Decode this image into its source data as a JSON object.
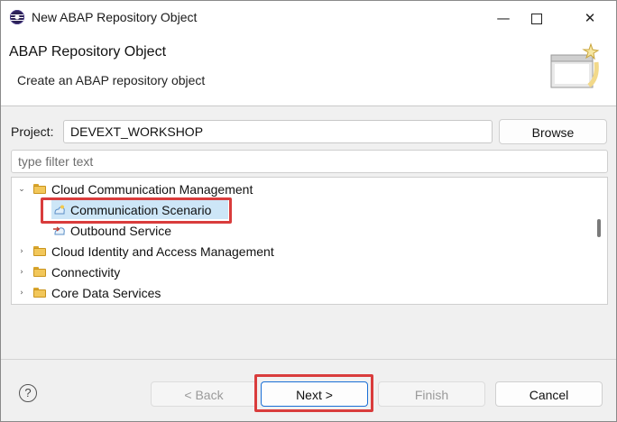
{
  "window": {
    "title": "New ABAP Repository Object"
  },
  "banner": {
    "title": "ABAP Repository Object",
    "subtitle": "Create an ABAP repository object"
  },
  "project": {
    "label": "Project:",
    "value": "DEVEXT_WORKSHOP",
    "browse_label": "Browse"
  },
  "filter": {
    "placeholder": "type filter text"
  },
  "tree": {
    "items": [
      {
        "label": "Cloud Communication Management",
        "expanded": true,
        "icon": "folder-icon"
      },
      {
        "label": "Communication Scenario",
        "selected": true,
        "icon": "communication-scenario-icon"
      },
      {
        "label": "Outbound Service",
        "icon": "outbound-service-icon"
      },
      {
        "label": "Cloud Identity and Access Management",
        "expanded": false,
        "icon": "folder-icon"
      },
      {
        "label": "Connectivity",
        "expanded": false,
        "icon": "folder-icon"
      },
      {
        "label": "Core Data Services",
        "expanded": false,
        "icon": "folder-icon"
      }
    ]
  },
  "footer": {
    "help_symbol": "?",
    "back_label": "< Back",
    "next_label": "Next >",
    "finish_label": "Finish",
    "cancel_label": "Cancel"
  },
  "colors": {
    "selection": "#cde6f7",
    "highlight": "#d93c3c",
    "default_button_border": "#1a6fd6"
  }
}
